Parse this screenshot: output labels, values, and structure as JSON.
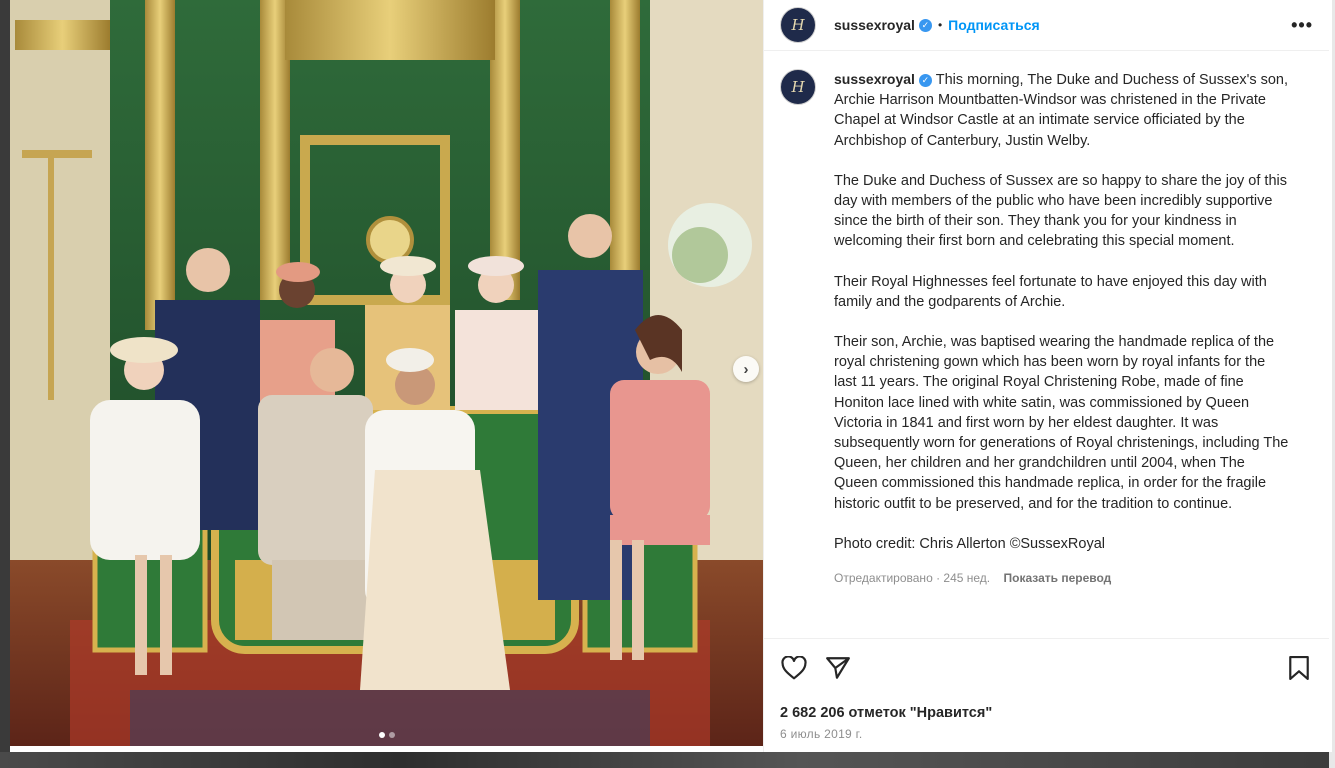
{
  "account": {
    "username": "sussexroyal",
    "avatar_letter": "H",
    "follow_label": "Подписаться",
    "separator": "•",
    "more_label": "•••"
  },
  "caption": {
    "paragraphs": [
      "This morning, The Duke and Duchess of Sussex's son, Archie Harrison Mountbatten-Windsor was christened in the Private Chapel at Windsor Castle at an intimate service officiated by the Archbishop of Canterbury, Justin Welby.",
      "The Duke and Duchess of Sussex are so happy to share the joy of this day with members of the public who have been incredibly supportive since the birth of their son. They thank you for your kindness in welcoming their first born and celebrating this special moment.",
      "Their Royal Highnesses feel fortunate to have enjoyed this day with family and the godparents of Archie.",
      "Their son, Archie, was baptised wearing the handmade replica of the royal christening gown which has been worn by royal infants for the last 11 years. The original Royal Christening Robe, made of fine Honiton lace lined with white satin, was commissioned by Queen Victoria in 1841 and first worn by her eldest daughter. It was subsequently worn for generations of Royal christenings, including The Queen, her children and her grandchildren until 2004, when The Queen commissioned this handmade replica, in order for the fragile historic outfit to be preserved, and for the tradition to continue.",
      "Photo credit: Chris Allerton ©SussexRoyal"
    ],
    "edited_label": "Отредактировано · 245 нед.",
    "translate_label": "Показать перевод"
  },
  "footer": {
    "likes": "2 682 206 отметок \"Нравится\"",
    "date": "6 июль 2019 г."
  },
  "icons": {
    "like": "heart-icon",
    "share": "paper-plane-icon",
    "save": "bookmark-icon",
    "next": "chevron-right-icon"
  },
  "carousel": {
    "next_glyph": "›"
  }
}
